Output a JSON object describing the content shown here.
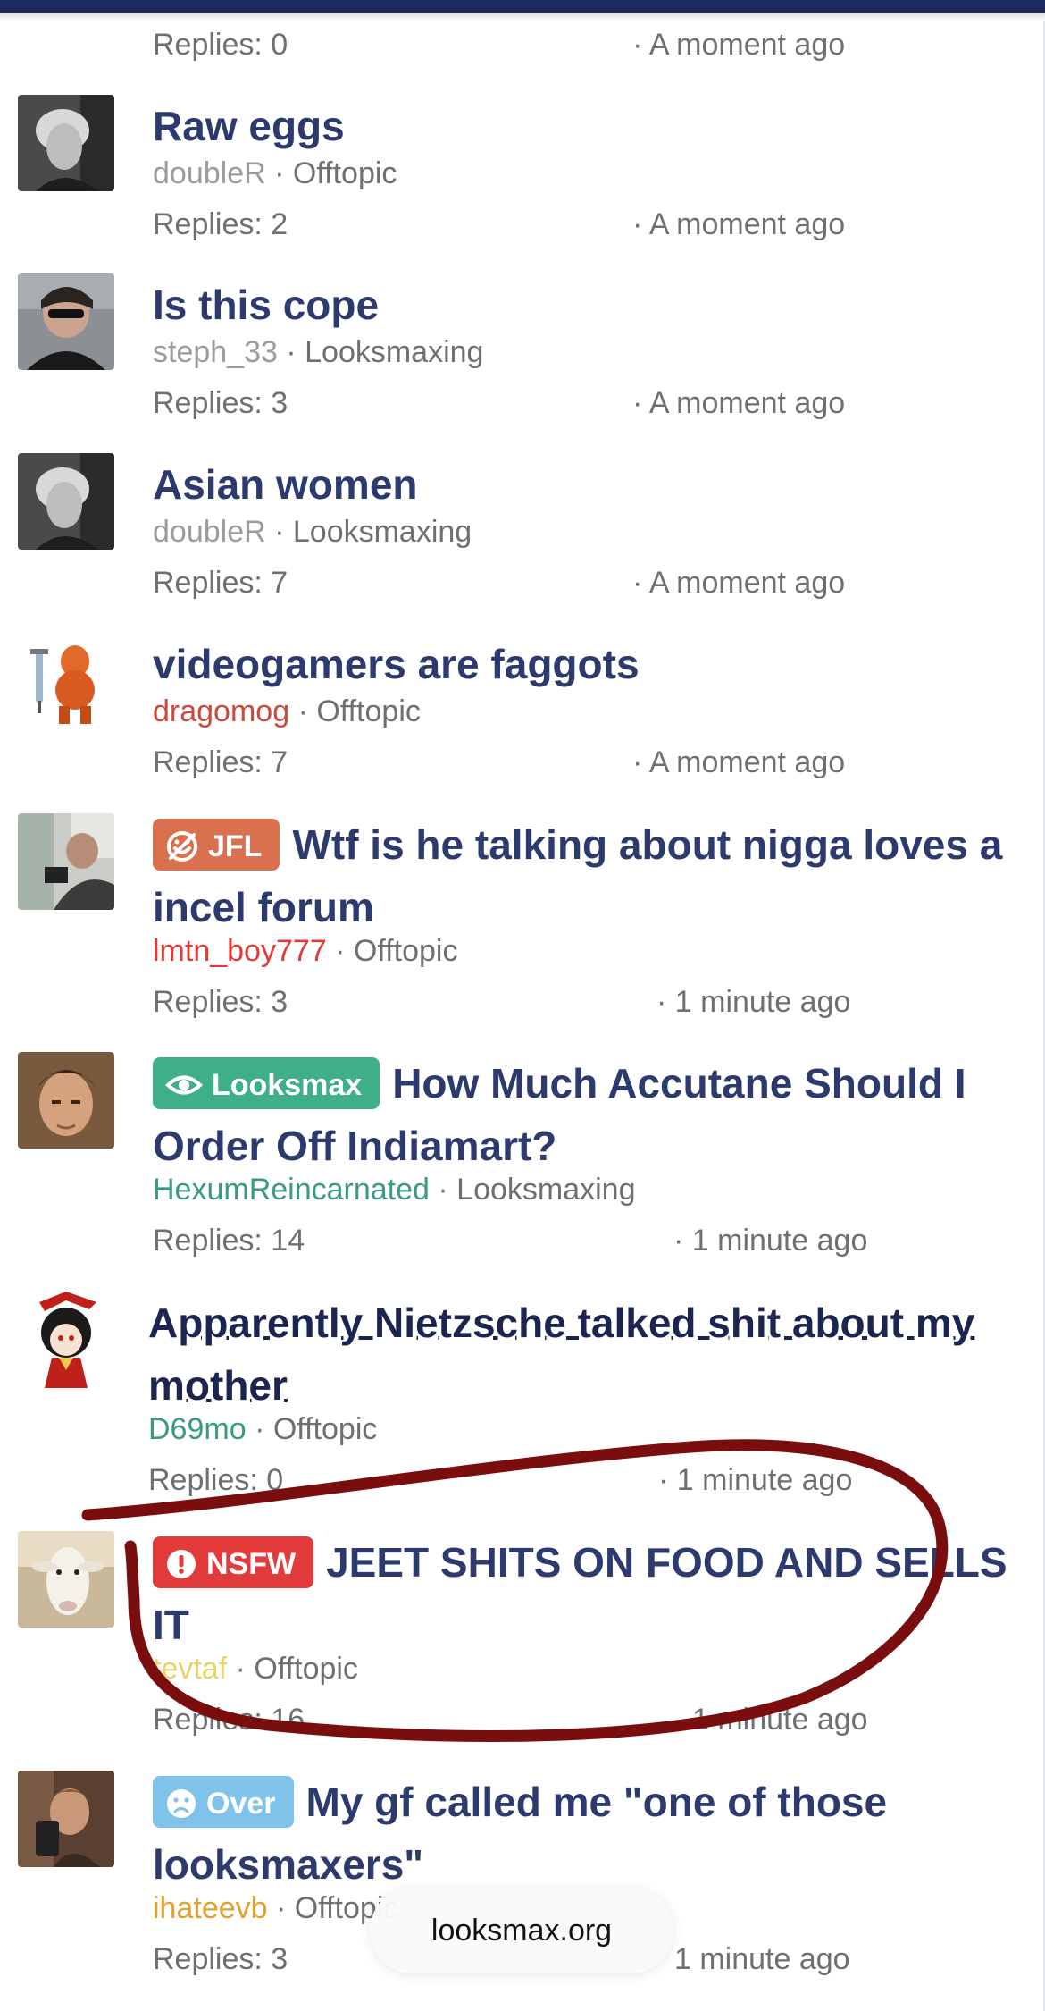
{
  "top_row": {
    "replies": "Replies: 0",
    "time": "· A moment ago"
  },
  "threads": [
    {
      "avatar": "avatar-bw-blond",
      "title": "Raw eggs",
      "author": "doubleR",
      "forum": "· Offtopic",
      "replies": "Replies: 2",
      "time": "· A moment ago"
    },
    {
      "avatar": "avatar-sunglasses",
      "title": "Is this cope",
      "author": "steph_33",
      "forum": "· Looksmaxing",
      "replies": "Replies: 3",
      "time": "· A moment ago"
    },
    {
      "avatar": "avatar-bw-blond",
      "title": "Asian women",
      "author": "doubleR",
      "forum": "· Looksmaxing",
      "replies": "Replies: 7",
      "time": "· A moment ago"
    },
    {
      "avatar": "avatar-muscle-cartoon",
      "title": "videogamers are faggots",
      "author": "dragomog",
      "forum": "· Offtopic",
      "replies": "Replies: 7",
      "time": "· A moment ago"
    },
    {
      "avatar": "avatar-photo-man",
      "prefix": "JFL",
      "prefix_icon": "no-laugh-icon",
      "title": "Wtf is he talking about nigga loves a incel forum",
      "author": "lmtn_boy777",
      "forum": "· Offtopic",
      "replies": "Replies: 3",
      "time": "· 1 minute ago"
    },
    {
      "avatar": "avatar-model-face",
      "prefix": "Looksmax",
      "prefix_icon": "eye-icon",
      "title": "How Much Accutane Should I Order Off Indiamart?",
      "author": "HexumReincarnated",
      "forum": "· Looksmaxing",
      "replies": "Replies: 14",
      "time": "· 1 minute ago"
    },
    {
      "avatar": "avatar-anime-girl",
      "title": "Apparently Nietzsche talked shit about my mother",
      "author": "D69mo",
      "forum": "· Offtopic",
      "replies": "Replies: 0",
      "time": "· 1 minute ago"
    },
    {
      "avatar": "avatar-goat",
      "prefix": "NSFW",
      "prefix_icon": "alert-icon",
      "title": "JEET SHITS ON FOOD AND SELLS IT",
      "author": "tevtaf",
      "forum": "· Offtopic",
      "replies": "Replies: 16",
      "time": "1 minute ago"
    },
    {
      "avatar": "avatar-selfie",
      "prefix": "Over",
      "prefix_icon": "sad-face-icon",
      "title": "My gf called me \"one of those looksmaxers\"",
      "author": "ihateevb",
      "forum": "· Offtopic",
      "replies": "Replies: 3",
      "time": "1 minute ago"
    }
  ],
  "url_bar": {
    "domain": "looksmax.org"
  },
  "colors": {
    "title": "#2c3a6e",
    "meta": "#6d7073",
    "jfl": "#d9714f",
    "looksmax": "#3fae8a",
    "nsfw": "#e23b3b",
    "over": "#7fc3ea",
    "annotation": "#7a0d0d"
  }
}
